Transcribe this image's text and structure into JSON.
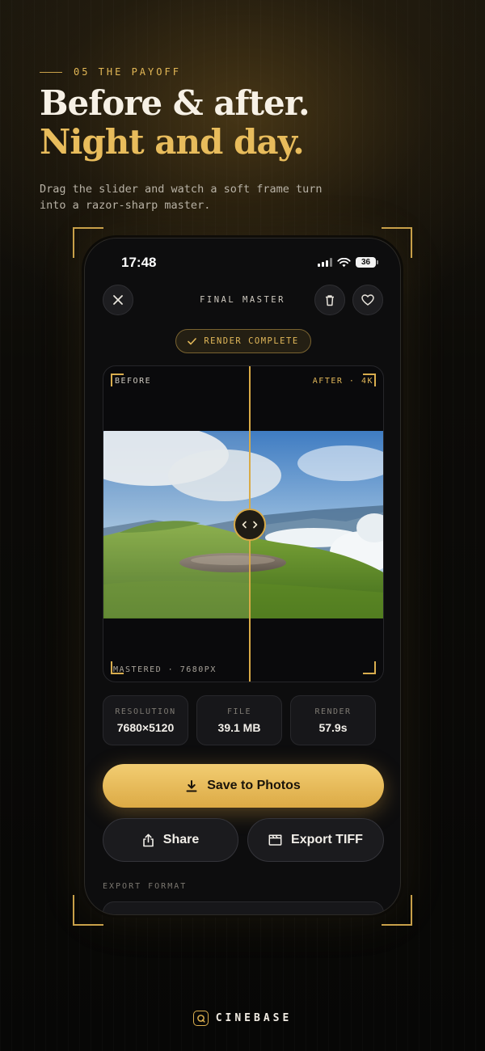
{
  "hero": {
    "eyebrow": "05 THE PAYOFF",
    "headline_line1": "Before & after.",
    "headline_line2": "Night and day.",
    "subcopy": "Drag the slider and watch a soft frame turn into a razor-sharp master."
  },
  "status_bar": {
    "time": "17:48",
    "battery": "36"
  },
  "nav": {
    "title": "FINAL MASTER",
    "close_icon": "close-icon",
    "delete_icon": "trash-icon",
    "favorite_icon": "heart-icon"
  },
  "badge": {
    "label": "RENDER COMPLETE",
    "icon": "check-icon"
  },
  "viewer": {
    "before_label": "BEFORE",
    "after_label": "AFTER · 4K",
    "footer_label": "MASTERED · 7680PX",
    "slider_position": 0.52,
    "handle_icon": "chevrons-left-right-icon"
  },
  "stats": [
    {
      "label": "RESOLUTION",
      "value": "7680×5120"
    },
    {
      "label": "FILE",
      "value": "39.1 MB"
    },
    {
      "label": "RENDER",
      "value": "57.9s"
    }
  ],
  "actions": {
    "save": "Save to Photos",
    "share": "Share",
    "export": "Export TIFF"
  },
  "export_section": {
    "label": "EXPORT FORMAT"
  },
  "brand": {
    "name": "CINEBASE"
  },
  "colors": {
    "accent": "#E3B856",
    "background": "#0C0B08",
    "card": "#17171A"
  }
}
